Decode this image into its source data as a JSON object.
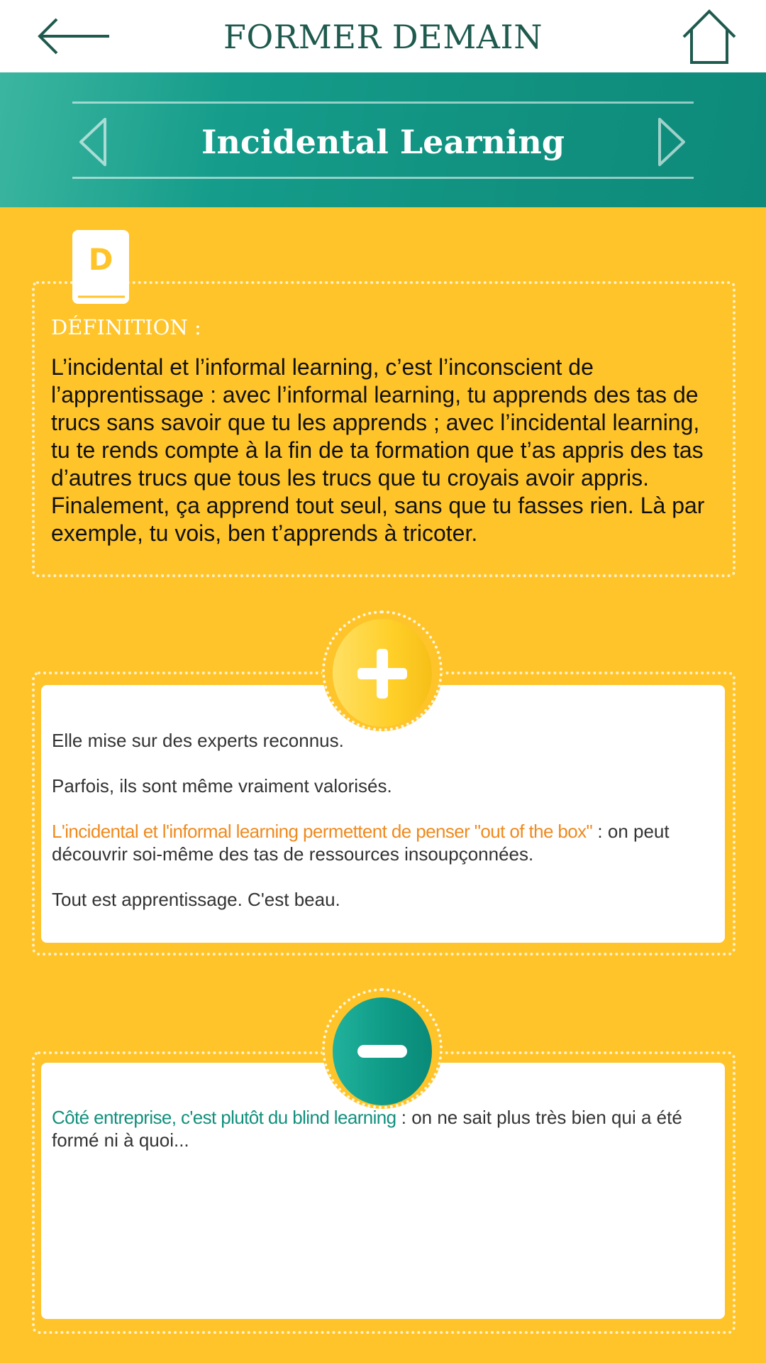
{
  "header": {
    "title": "FORMER DEMAIN",
    "back_icon": "arrow-left-icon",
    "home_icon": "home-icon"
  },
  "topic": {
    "title": "Incidental Learning",
    "prev_icon": "chevron-left-icon",
    "next_icon": "chevron-right-icon",
    "band_color": "#159c8a"
  },
  "definition": {
    "icon": "book-d-icon",
    "icon_letter": "D",
    "label": "DÉFINITION :",
    "text": "L’incidental et l’informal learning, c’est l’inconscient de l’apprentissage : avec l’informal learning, tu apprends des tas de trucs sans savoir que tu les apprends ; avec l’incidental learning, tu te rends compte à la fin de ta formation que t’as appris des tas d’autres trucs que tous les trucs que tu croyais avoir appris. Finalement, ça apprend tout seul, sans que tu fasses rien. Là par exemple, tu vois, ben t’apprends à tricoter."
  },
  "pros": {
    "icon": "plus-icon",
    "p1": "Elle mise sur des experts reconnus.",
    "p2": "Parfois, ils sont même vraiment valorisés.",
    "p3_highlight": "L'incidental et l'informal learning permettent de penser \"out of the box\"",
    "p3_rest": " : on peut découvrir soi-même des tas de ressources insoupçonnées.",
    "p4": "Tout est apprentissage. C'est beau."
  },
  "cons": {
    "icon": "minus-icon",
    "p1_highlight": "Côté entreprise, c'est plutôt du blind learning",
    "p1_rest": " :  on ne sait plus très bien qui a été formé ni à quoi..."
  },
  "colors": {
    "background": "#ffc42a",
    "accent_teal": "#12907d",
    "accent_orange": "#ef8a1e",
    "title_dark_green": "#1f5a4e"
  }
}
